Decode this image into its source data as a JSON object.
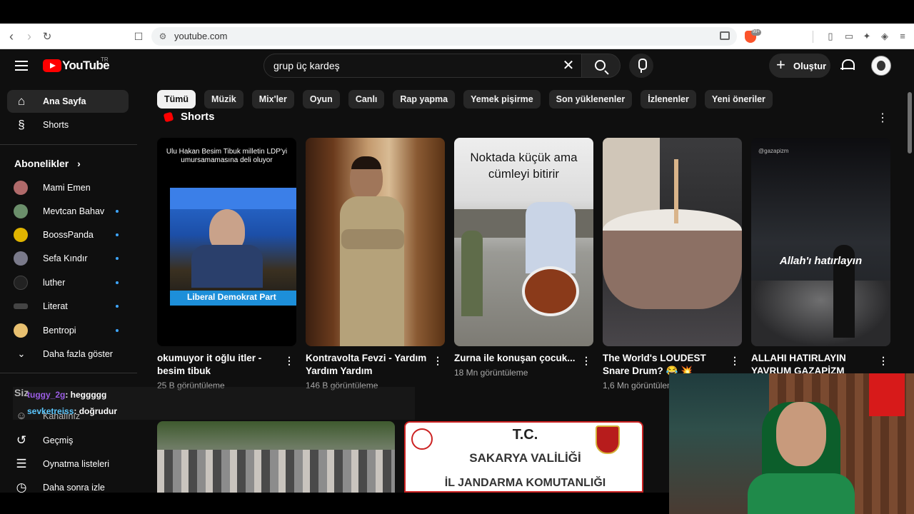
{
  "browser": {
    "url": "youtube.com",
    "brave_badge": "99+"
  },
  "masthead": {
    "logo_text": "YouTube",
    "logo_region": "TR",
    "search_query": "grup üç kardeş",
    "create_label": "Oluştur"
  },
  "chips": [
    {
      "label": "Tümü",
      "active": true
    },
    {
      "label": "Müzik"
    },
    {
      "label": "Mix'ler"
    },
    {
      "label": "Oyun"
    },
    {
      "label": "Canlı"
    },
    {
      "label": "Rap yapma"
    },
    {
      "label": "Yemek pişirme"
    },
    {
      "label": "Son yüklenenler"
    },
    {
      "label": "İzlenenler"
    },
    {
      "label": "Yeni öneriler"
    }
  ],
  "sidebar": {
    "main": [
      {
        "label": "Ana Sayfa",
        "icon": "home-icon"
      },
      {
        "label": "Shorts",
        "icon": "shorts-icon"
      }
    ],
    "subscriptions_heading": "Abonelikler",
    "subscriptions": [
      {
        "label": "Mami Emen",
        "color": "#b06a6a",
        "dot": false
      },
      {
        "label": "Mevtcan Bahav",
        "color": "#6b8f6b",
        "dot": true
      },
      {
        "label": "BoossPanda",
        "color": "#e0b400",
        "dot": true
      },
      {
        "label": "Sefa Kındır",
        "color": "#7a7a8a",
        "dot": true
      },
      {
        "label": "luther",
        "color": "#222222",
        "dot": true
      },
      {
        "label": "Literat",
        "color": "#444444",
        "dot": true
      },
      {
        "label": "Bentropi",
        "color": "#e8c070",
        "dot": true
      }
    ],
    "show_more": "Daha fazla göster",
    "you_heading": "Siz",
    "you_items": [
      {
        "label": "Kanalınız",
        "icon": "channel-icon"
      },
      {
        "label": "Geçmiş",
        "icon": "history-icon"
      },
      {
        "label": "Oynatma listeleri",
        "icon": "playlist-icon"
      },
      {
        "label": "Daha sonra izle",
        "icon": "watch-later-icon"
      }
    ]
  },
  "shorts": {
    "title": "Shorts",
    "items": [
      {
        "title": "okumuyor it oğlu itler - besim tibuk",
        "views": "25 B görüntüleme",
        "overlay_top": "Ulu Hakan Besim Tibuk milletin LDP'yi umursamamasına deli oluyor",
        "overlay_banner": "Liberal Demokrat Part"
      },
      {
        "title": "Kontravolta Fevzi - Yardım Yardım Yardım",
        "views": "146 B görüntüleme"
      },
      {
        "title": "Zurna ile konuşan çocuk...",
        "views": "18 Mn görüntüleme",
        "overlay_text": "Noktada küçük ama cümleyi bitirir"
      },
      {
        "title": "The World's LOUDEST Snare Drum? 😂 💥",
        "views": "1,6 Mn görüntüleme"
      },
      {
        "title": "ALLAHI HATIRLAYIN YAVRUM GAZAPİZM",
        "views": "",
        "overlay_text": "Allah'ı hatırlayın",
        "watermark": "@gazapizm"
      }
    ]
  },
  "videos": [
    {
      "thumb_text": ""
    },
    {
      "thumb_line1": "T.C.",
      "thumb_line2": "SAKARYA VALİLİĞİ",
      "thumb_line3": "İL JANDARMA KOMUTANLIĞI"
    }
  ],
  "chat": [
    {
      "user": "tuggy_2g",
      "message": ": heggggg"
    },
    {
      "user": "sevketreiss",
      "message": ": doğrudur"
    }
  ],
  "colors": {
    "brand_red": "#ff0000",
    "background": "#0f0f0f",
    "chip": "#272727",
    "unread_dot": "#3ea6ff"
  }
}
